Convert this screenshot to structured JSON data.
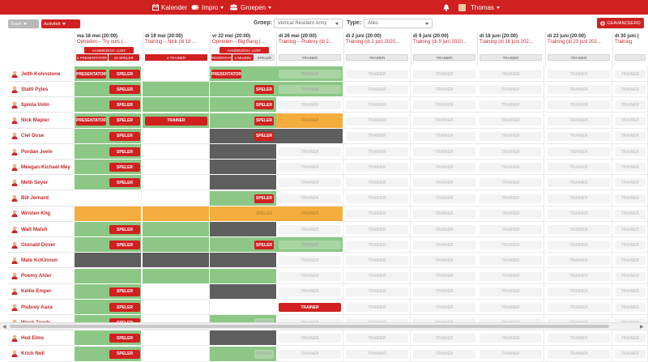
{
  "topbar": {
    "kalender": "Kalender",
    "impro": "Impro",
    "groepen": "Groepen",
    "user": "Thomas"
  },
  "filters": {
    "team_pill": "Team",
    "activiteit_pill": "Activiteit",
    "groep_label": "Groep:",
    "groep_value": "Vertical Resident Army",
    "type_label": "Type:",
    "type_value": "Alles",
    "advanced_button": "GEAVANCEERD"
  },
  "columns": [
    {
      "date": "ma 18 mei (20:00)",
      "title": "Optreden – Try outs (...",
      "buttons": [
        {
          "label": "AANWEZIGH. LIJST",
          "style": "red"
        },
        {
          "label": "2 PRESENTATOR",
          "style": "red"
        },
        {
          "label": "10 SPELER",
          "style": "red"
        }
      ]
    },
    {
      "date": "di 19 mei (20:00)",
      "title": "Training – Nick (di 19 ...",
      "buttons": [
        {
          "label": "4 TRAINER",
          "style": "red"
        }
      ]
    },
    {
      "date": "vr 22 mei (20:00)",
      "title": "Optreden – Big Bang (...",
      "buttons": [
        {
          "label": "AANWEZIGH. LIJST",
          "style": "red"
        },
        {
          "label": "1 PRESENTATOR",
          "style": "red"
        },
        {
          "label": "1 MUZIEK",
          "style": "red"
        },
        {
          "label": "SPELER",
          "style": "grey"
        }
      ]
    },
    {
      "date": "di 26 mei (20:00)",
      "title": "Training – Piubrey (di 2...",
      "buttons": [
        {
          "label": "TRAINER",
          "style": "grey"
        }
      ]
    },
    {
      "date": "di 2 juni (20:00)",
      "title": "Training (di 2 juni 2020...",
      "buttons": [
        {
          "label": "TRAINER",
          "style": "grey"
        }
      ]
    },
    {
      "date": "di 9 juni (20:00)",
      "title": "Training (di 9 juni 2020...",
      "buttons": [
        {
          "label": "TRAINER",
          "style": "grey"
        }
      ]
    },
    {
      "date": "di 16 juni (20:00)",
      "title": "Training (di 16 juni 202...",
      "buttons": [
        {
          "label": "TRAINER",
          "style": "grey"
        }
      ]
    },
    {
      "date": "di 23 juni (20:00)",
      "title": "Training (di 23 juni 202...",
      "buttons": [
        {
          "label": "TRAINER",
          "style": "grey"
        }
      ]
    },
    {
      "date": "di 30 juni (",
      "title": "Training",
      "buttons": [
        {
          "label": "",
          "style": "grey"
        }
      ]
    }
  ],
  "players": [
    "Jelth Kohnstone",
    "Statti Pyles",
    "Spiola Volin",
    "Nick Mapier",
    "Clel Dose",
    "Pordan Jeele",
    "Meegan-Kichael Mey",
    "Meth Seyer",
    "Bill Jernard",
    "Wristen Klig",
    "Watt Malsh",
    "Glonald Dover",
    "Mate KcKinnon",
    "Poemy Ahler",
    "Kellie Emper",
    "Piubrey Aaza",
    "Wach Zoods",
    "Hed Elms",
    "Krick Noll"
  ],
  "grid": [
    [
      [
        "g",
        "Presentator",
        "Speler"
      ],
      [
        "w"
      ],
      [
        "g",
        "Presentator",
        ""
      ],
      [
        "g",
        "",
        "Trainer~"
      ],
      [
        "w",
        "",
        "Trainer~"
      ],
      [
        "w",
        "",
        "Trainer~"
      ],
      [
        "w",
        "",
        "Trainer~"
      ],
      [
        "w",
        "",
        "Trainer~"
      ],
      [
        "w",
        "",
        "Trainer~"
      ]
    ],
    [
      [
        "g",
        "",
        "Speler"
      ],
      [
        "g"
      ],
      [
        "g",
        "",
        "Speler"
      ],
      [
        "g",
        "",
        "Trainer~"
      ],
      [
        "w",
        "",
        "Trainer~"
      ],
      [
        "w",
        "",
        "Trainer~"
      ],
      [
        "w",
        "",
        "Trainer~"
      ],
      [
        "w",
        "",
        "Trainer~"
      ],
      [
        "w",
        "",
        "Trainer~"
      ]
    ],
    [
      [
        "g",
        "",
        "Speler"
      ],
      [
        "g"
      ],
      [
        "g",
        "",
        "Speler"
      ],
      [
        "w",
        "",
        "Trainer~"
      ],
      [
        "w",
        "",
        "Trainer~"
      ],
      [
        "w",
        "",
        "Trainer~"
      ],
      [
        "w",
        "",
        "Trainer~"
      ],
      [
        "w",
        "",
        "Trainer~"
      ],
      [
        "w",
        "",
        "Trainer~"
      ]
    ],
    [
      [
        "g",
        "Presentator",
        "Speler"
      ],
      [
        "g",
        "",
        "Trainer"
      ],
      [
        "g",
        "",
        "Speler"
      ],
      [
        "o",
        "",
        "Trainer~"
      ],
      [
        "w",
        "",
        "Trainer~"
      ],
      [
        "w",
        "",
        "Trainer~"
      ],
      [
        "w",
        "",
        "Trainer~"
      ],
      [
        "w",
        "",
        "Trainer~"
      ],
      [
        "w",
        "",
        "Trainer~"
      ]
    ],
    [
      [
        "g",
        "",
        "Speler"
      ],
      [
        "w"
      ],
      [
        "d",
        "",
        "Speler"
      ],
      [
        "d"
      ],
      [
        "w",
        "",
        "Trainer~"
      ],
      [
        "w",
        "",
        "Trainer~"
      ],
      [
        "w",
        "",
        "Trainer~"
      ],
      [
        "w",
        "",
        "Trainer~"
      ],
      [
        "w",
        "",
        "Trainer~"
      ]
    ],
    [
      [
        "g",
        "",
        "Speler"
      ],
      [
        "w"
      ],
      [
        "d"
      ],
      [
        "w",
        "",
        "Trainer~"
      ],
      [
        "w",
        "",
        "Trainer~"
      ],
      [
        "w",
        "",
        "Trainer~"
      ],
      [
        "w",
        "",
        "Trainer~"
      ],
      [
        "w",
        "",
        "Trainer~"
      ],
      [
        "w",
        "",
        "Trainer~"
      ]
    ],
    [
      [
        "g",
        "",
        "Speler"
      ],
      [
        "w"
      ],
      [
        "d"
      ],
      [
        "w",
        "",
        "Trainer~"
      ],
      [
        "w",
        "",
        "Trainer~"
      ],
      [
        "w",
        "",
        "Trainer~"
      ],
      [
        "w",
        "",
        "Trainer~"
      ],
      [
        "w",
        "",
        "Trainer~"
      ],
      [
        "w",
        "",
        "Trainer~"
      ]
    ],
    [
      [
        "g",
        "",
        "Speler"
      ],
      [
        "w"
      ],
      [
        "d"
      ],
      [
        "w",
        "",
        "Trainer~"
      ],
      [
        "w",
        "",
        "Trainer~"
      ],
      [
        "w",
        "",
        "Trainer~"
      ],
      [
        "w",
        "",
        "Trainer~"
      ],
      [
        "w",
        "",
        "Trainer~"
      ],
      [
        "w",
        "",
        "Trainer~"
      ]
    ],
    [
      [
        "w"
      ],
      [
        "w"
      ],
      [
        "g",
        "",
        "Speler"
      ],
      [
        "w",
        "",
        "Trainer~"
      ],
      [
        "w",
        "",
        "Trainer~"
      ],
      [
        "w",
        "",
        "Trainer~"
      ],
      [
        "w",
        "",
        "Trainer~"
      ],
      [
        "w",
        "",
        "Trainer~"
      ],
      [
        "w",
        "",
        "Trainer~"
      ]
    ],
    [
      [
        "o"
      ],
      [
        "o"
      ],
      [
        "o",
        "",
        "Speler~"
      ],
      [
        "o",
        "",
        "Trainer~"
      ],
      [
        "w",
        "",
        "Trainer~"
      ],
      [
        "w",
        "",
        "Trainer~"
      ],
      [
        "w",
        "",
        "Trainer~"
      ],
      [
        "w",
        "",
        "Trainer~"
      ],
      [
        "w",
        "",
        "Trainer~"
      ]
    ],
    [
      [
        "g",
        "",
        "Speler"
      ],
      [
        "g"
      ],
      [
        "d"
      ],
      [
        "w",
        "",
        "Trainer~"
      ],
      [
        "w",
        "",
        "Trainer~"
      ],
      [
        "w",
        "",
        "Trainer~"
      ],
      [
        "w",
        "",
        "Trainer~"
      ],
      [
        "w",
        "",
        "Trainer~"
      ],
      [
        "w",
        "",
        "Trainer~"
      ]
    ],
    [
      [
        "g",
        "",
        "Speler"
      ],
      [
        "g"
      ],
      [
        "g",
        "",
        "Speler"
      ],
      [
        "g",
        "",
        "Trainer~"
      ],
      [
        "w",
        "",
        "Trainer~"
      ],
      [
        "w",
        "",
        "Trainer~"
      ],
      [
        "w",
        "",
        "Trainer~"
      ],
      [
        "w",
        "",
        "Trainer~"
      ],
      [
        "w",
        "",
        "Trainer~"
      ]
    ],
    [
      [
        "d"
      ],
      [
        "d"
      ],
      [
        "d"
      ],
      [
        "w",
        "",
        "Trainer~"
      ],
      [
        "w",
        "",
        "Trainer~"
      ],
      [
        "w",
        "",
        "Trainer~"
      ],
      [
        "w",
        "",
        "Trainer~"
      ],
      [
        "w",
        "",
        "Trainer~"
      ],
      [
        "w",
        "",
        "Trainer~"
      ]
    ],
    [
      [
        "g"
      ],
      [
        "g"
      ],
      [
        "g"
      ],
      [
        "w",
        "",
        "Trainer~"
      ],
      [
        "w",
        "",
        "Trainer~"
      ],
      [
        "w",
        "",
        "Trainer~"
      ],
      [
        "w",
        "",
        "Trainer~"
      ],
      [
        "w",
        "",
        "Trainer~"
      ],
      [
        "w",
        "",
        "Trainer~"
      ]
    ],
    [
      [
        "g",
        "",
        "Speler"
      ],
      [
        "w"
      ],
      [
        "d"
      ],
      [
        "w",
        "",
        "Trainer~"
      ],
      [
        "w",
        "",
        "Trainer~"
      ],
      [
        "w",
        "",
        "Trainer~"
      ],
      [
        "w",
        "",
        "Trainer~"
      ],
      [
        "w",
        "",
        "Trainer~"
      ],
      [
        "w",
        "",
        "Trainer~"
      ]
    ],
    [
      [
        "g",
        "",
        "Speler"
      ],
      [
        "w"
      ],
      [
        "w"
      ],
      [
        "w",
        "",
        "Trainer"
      ],
      [
        "w",
        "",
        "Trainer~"
      ],
      [
        "w",
        "",
        "Trainer~"
      ],
      [
        "w",
        "",
        "Trainer~"
      ],
      [
        "w",
        "",
        "Trainer~"
      ],
      [
        "w",
        "",
        "Trainer~"
      ]
    ],
    [
      [
        "g",
        "",
        "Speler"
      ],
      [
        "w"
      ],
      [
        "g",
        "",
        "Speler~"
      ],
      [
        "w",
        "",
        "Trainer~"
      ],
      [
        "w",
        "",
        "Trainer~"
      ],
      [
        "w",
        "",
        "Trainer~"
      ],
      [
        "w",
        "",
        "Trainer~"
      ],
      [
        "w",
        "",
        "Trainer~"
      ],
      [
        "w",
        "",
        "Trainer~"
      ]
    ],
    [
      [
        "g",
        "",
        "Speler"
      ],
      [
        "w"
      ],
      [
        "d"
      ],
      [
        "w",
        "",
        "Trainer~"
      ],
      [
        "w",
        "",
        "Trainer~"
      ],
      [
        "w",
        "",
        "Trainer~"
      ],
      [
        "w",
        "",
        "Trainer~"
      ],
      [
        "w",
        "",
        "Trainer~"
      ],
      [
        "w",
        "",
        "Trainer~"
      ]
    ],
    [
      [
        "g",
        "",
        "Speler"
      ],
      [
        "w"
      ],
      [
        "g",
        "",
        "Speler~"
      ],
      [
        "w",
        "",
        "Trainer~"
      ],
      [
        "w",
        "",
        "Trainer~"
      ],
      [
        "w",
        "",
        "Trainer~"
      ],
      [
        "w",
        "",
        "Trainer~"
      ],
      [
        "w",
        "",
        "Trainer~"
      ],
      [
        "w",
        "",
        "Trainer~"
      ]
    ]
  ],
  "colors": {
    "brand": "#d02020",
    "green": "#8cc785",
    "orange": "#f5ad3e",
    "dark": "#5e5e5e"
  }
}
